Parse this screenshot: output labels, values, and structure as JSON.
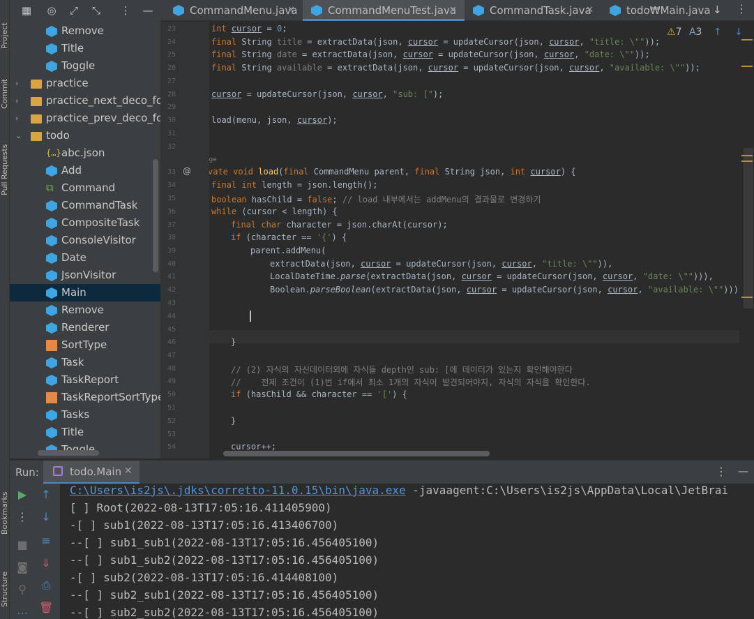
{
  "side_tabs": {
    "project": "Project",
    "commit": "Commit",
    "pull_requests": "Pull Requests",
    "bookmarks": "Bookmarks",
    "structure": "Structure"
  },
  "project_tree": [
    {
      "label": "Remove",
      "icon": "class-icon",
      "indent": 2
    },
    {
      "label": "Title",
      "icon": "class-icon",
      "indent": 2
    },
    {
      "label": "Toggle",
      "icon": "class-icon",
      "indent": 2
    },
    {
      "label": "practice",
      "icon": "folder-icon",
      "indent": 1,
      "arrow": "›"
    },
    {
      "label": "practice_next_deco_for_a",
      "icon": "folder-icon",
      "indent": 1,
      "arrow": "›"
    },
    {
      "label": "practice_prev_deco_for_s",
      "icon": "folder-icon",
      "indent": 1,
      "arrow": "›"
    },
    {
      "label": "todo",
      "icon": "folder-icon",
      "indent": 1,
      "arrow": "⌄"
    },
    {
      "label": "abc.json",
      "icon": "json-icon",
      "indent": 2
    },
    {
      "label": "Add",
      "icon": "class-icon",
      "indent": 2
    },
    {
      "label": "Command",
      "icon": "interface-icon",
      "indent": 2
    },
    {
      "label": "CommandTask",
      "icon": "class-icon",
      "indent": 2
    },
    {
      "label": "CompositeTask",
      "icon": "class-icon",
      "indent": 2
    },
    {
      "label": "ConsoleVisitor",
      "icon": "class-icon",
      "indent": 2
    },
    {
      "label": "Date",
      "icon": "class-icon",
      "indent": 2
    },
    {
      "label": "JsonVisitor",
      "icon": "class-icon",
      "indent": 2
    },
    {
      "label": "Main",
      "icon": "class-icon",
      "indent": 2,
      "selected": true
    },
    {
      "label": "Remove",
      "icon": "class-icon",
      "indent": 2
    },
    {
      "label": "Renderer",
      "icon": "class-icon",
      "indent": 2
    },
    {
      "label": "SortType",
      "icon": "enum-icon",
      "indent": 2
    },
    {
      "label": "Task",
      "icon": "class-icon",
      "indent": 2
    },
    {
      "label": "TaskReport",
      "icon": "class-icon",
      "indent": 2
    },
    {
      "label": "TaskReportSortType",
      "icon": "enum-icon",
      "indent": 2
    },
    {
      "label": "Tasks",
      "icon": "class-icon",
      "indent": 2
    },
    {
      "label": "Title",
      "icon": "class-icon",
      "indent": 2
    },
    {
      "label": "Toggle",
      "icon": "class-icon",
      "indent": 2
    }
  ],
  "tabs": [
    {
      "label": "CommandMenu.java",
      "active": false
    },
    {
      "label": "CommandMenuTest.java",
      "active": true
    },
    {
      "label": "CommandTask.java",
      "active": false
    },
    {
      "label": "todo₩Main.java",
      "active": false
    }
  ],
  "inspections": {
    "warnings": "7",
    "typos": "3"
  },
  "code_lines": [
    {
      "n": "23",
      "html": "<span class='kw'>int</span> <span class='un'>cursor</span> = <span style='color:#6897bb'>0</span>;",
      "indent": 0
    },
    {
      "n": "24",
      "html": "<span class='kw'>final</span> String <span style='color:#808080'>title</span> = extractData(json, <span class='un'>cursor</span> = updateCursor(json, <span class='un'>cursor</span>, <span class='str'>\"title: \\\"\"</span>));",
      "indent": 0
    },
    {
      "n": "25",
      "html": "<span class='kw'>final</span> String <span style='color:#808080'>date</span> = extractData(json, <span class='un'>cursor</span> = updateCursor(json, <span class='un'>cursor</span>, <span class='str'>\"date: \\\"\"</span>));",
      "indent": 0
    },
    {
      "n": "26",
      "html": "<span class='kw'>final</span> String <span style='color:#808080'>available</span> = extractData(json, <span class='un'>cursor</span> = updateCursor(json, <span class='un'>cursor</span>, <span class='str'>\"available: \\\"\"</span>));",
      "indent": 0
    },
    {
      "n": "27",
      "html": "",
      "indent": 0
    },
    {
      "n": "28",
      "html": "<span class='un'>cursor</span> = updateCursor(json, <span class='un'>cursor</span>, <span class='str'>\"sub: [\"</span>);",
      "indent": 0
    },
    {
      "n": "29",
      "html": "",
      "indent": 0
    },
    {
      "n": "30",
      "html": "load(menu, json, <span class='un'>cursor</span>);",
      "indent": 0
    },
    {
      "n": "31",
      "html": "",
      "indent": 0
    },
    {
      "n": "32",
      "html": "",
      "indent": 0
    },
    {
      "n": "33",
      "html": "<span class='kw'>vate void</span> <span class='fn'>load</span>(<span class='kw'>final</span> CommandMenu parent, <span class='kw'>final</span> String json, <span class='kw'>int</span> <span class='un'>cursor</span>) {",
      "indent": -1
    },
    {
      "n": "34",
      "html": "<span class='kw'>final int</span> length = json.length();",
      "indent": 0
    },
    {
      "n": "35",
      "html": "<span class='kw'>boolean</span> hasChild = <span class='kw'>false</span>; <span class='cmt'>// load 내부에서는 addMenu의 결과물로 변경하기</span>",
      "indent": 0
    },
    {
      "n": "36",
      "html": "<span class='kw'>while</span> (cursor &lt; length) {",
      "indent": 0
    },
    {
      "n": "37",
      "html": "<span class='kw'>final char</span> character = json.charAt(cursor);",
      "indent": 1
    },
    {
      "n": "38",
      "html": "<span class='kw'>if</span> (character == <span class='str'>'{'</span>) {",
      "indent": 1
    },
    {
      "n": "39",
      "html": "parent.addMenu(",
      "indent": 2
    },
    {
      "n": "40",
      "html": "extractData(json, <span class='un'>cursor</span> = updateCursor(json, <span class='un'>cursor</span>, <span class='str'>\"title: \\\"\"</span>)),",
      "indent": 3
    },
    {
      "n": "41",
      "html": "LocalDateTime.<i>parse</i>(extractData(json, <span class='un'>cursor</span> = updateCursor(json, <span class='un'>cursor</span>, <span class='str'>\"date: \\\"\"</span>))),",
      "indent": 3
    },
    {
      "n": "42",
      "html": "Boolean.<i>parseBoolean</i>(extractData(json, <span class='un'>cursor</span> = updateCursor(json, <span class='un'>cursor</span>, <span class='str'>\"available: \\\"\"</span>))));",
      "indent": 3
    },
    {
      "n": "43",
      "html": "",
      "indent": 0
    },
    {
      "n": "44",
      "html": "",
      "indent": 0
    },
    {
      "n": "45",
      "html": "",
      "indent": 0
    },
    {
      "n": "46",
      "html": "}",
      "indent": 1
    },
    {
      "n": "47",
      "html": "",
      "indent": 0
    },
    {
      "n": "48",
      "html": "<span class='cmt'>// (2) 자식의 자신데이터외에 자식들 depth인 sub: [에 데이터가 있는지 확인해야한다</span>",
      "indent": 1
    },
    {
      "n": "49",
      "html": "<span class='cmt'>//    전제 조건이 (1)번 if에서 최소 1개의 자식이 발견되어야지, 자식의 자식을 확인한다.</span>",
      "indent": 1
    },
    {
      "n": "50",
      "html": "<span class='kw'>if</span> (hasChild &amp;&amp; character == <span class='str'>'['</span>) {",
      "indent": 1
    },
    {
      "n": "51",
      "html": "",
      "indent": 0
    },
    {
      "n": "52",
      "html": "}",
      "indent": 1
    },
    {
      "n": "53",
      "html": "",
      "indent": 0
    },
    {
      "n": "54",
      "html": "cursor++;",
      "indent": 1
    }
  ],
  "usage_hint": "age",
  "run": {
    "label": "Run:",
    "config_tab": "todo.Main",
    "command_link": "C:\\Users\\is2js\\.jdks\\corretto-11.0.15\\bin\\java.exe",
    "command_rest": " -javaagent:C:\\Users\\is2js\\AppData\\Local\\JetBrai",
    "output": [
      "[ ] Root(2022-08-13T17:05:16.411405900)",
      "-[ ] sub1(2022-08-13T17:05:16.413406700)",
      "--[ ] sub1_sub1(2022-08-13T17:05:16.456405100)",
      "--[ ] sub1_sub2(2022-08-13T17:05:16.456405100)",
      "-[ ] sub2(2022-08-13T17:05:16.414408100)",
      "--[ ] sub2_sub1(2022-08-13T17:05:16.456405100)",
      "--[ ] sub2_sub2(2022-08-13T17:05:16.456405100)"
    ]
  },
  "colors": {
    "accent": "#4a88c7",
    "class_icon": "#3fa4e0",
    "folder_icon": "#d9a441",
    "run_green": "#59a869"
  }
}
